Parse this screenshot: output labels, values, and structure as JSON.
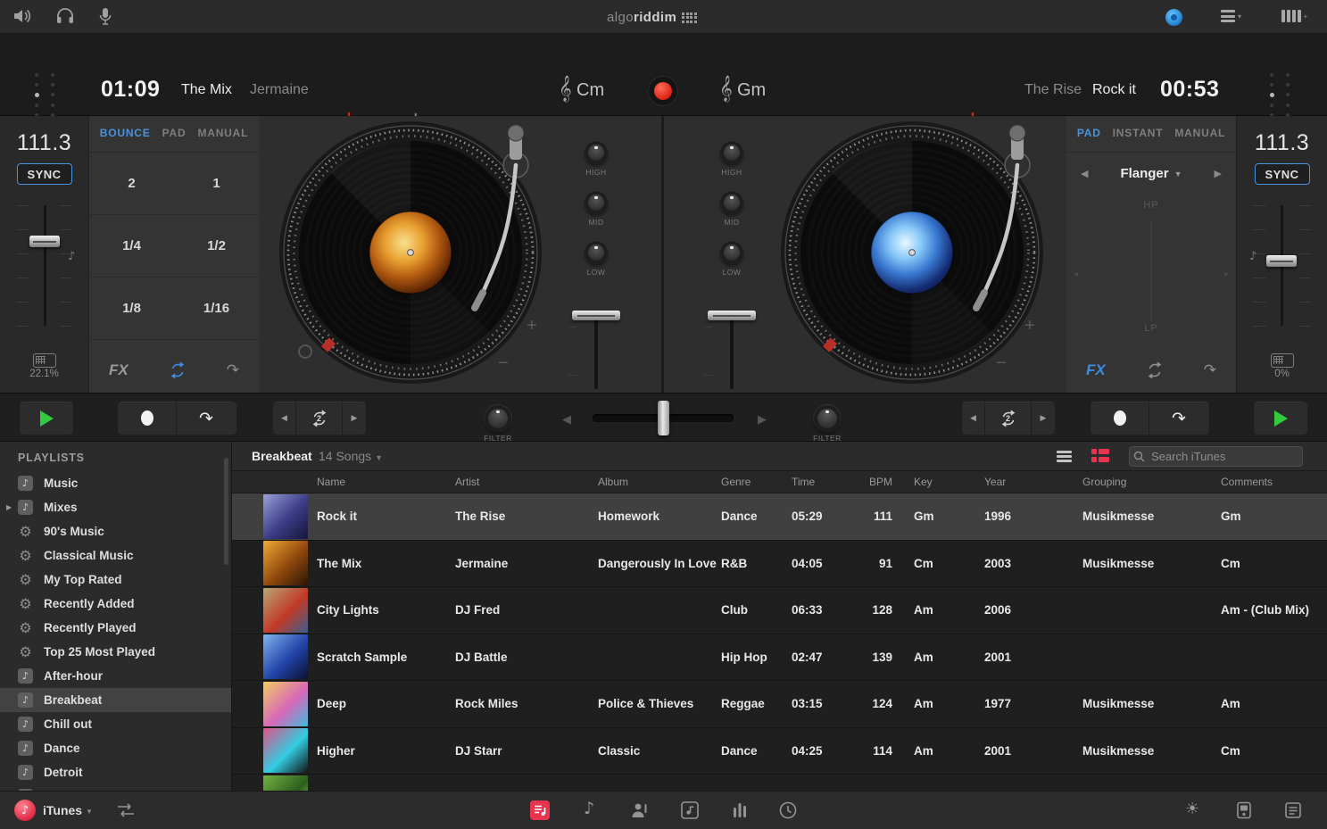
{
  "colors": {
    "accent_blue": "#4a93dd",
    "play_green": "#33cb3e",
    "record_red": "#d81f12",
    "active_pink": "#e8344e",
    "meter_green": "#3ed54b"
  },
  "menubar": {
    "logo_light": "algo",
    "logo_bold": "riddim"
  },
  "deck_a": {
    "time": "01:09",
    "title": "The Mix",
    "artist": "Jermaine",
    "key": "Cm",
    "bpm": "111.3",
    "sync_label": "SYNC",
    "pitch_pct": "22.1%",
    "tabs": [
      "BOUNCE",
      "PAD",
      "MANUAL"
    ],
    "active_tab": "BOUNCE",
    "loops": [
      "2",
      "1",
      "1/4",
      "1/2",
      "1/8",
      "1/16"
    ],
    "loop_len": "2",
    "fx_label": "FX"
  },
  "deck_b": {
    "time": "00:53",
    "title": "Rock it",
    "artist": "The Rise",
    "key": "Gm",
    "bpm": "111.3",
    "sync_label": "SYNC",
    "pitch_pct": "0%",
    "tabs": [
      "PAD",
      "INSTANT",
      "MANUAL"
    ],
    "active_tab": "PAD",
    "fx_name": "Flanger",
    "hp_label": "HP",
    "lp_label": "LP",
    "loop_len": "2",
    "fx_label": "FX"
  },
  "mixer": {
    "eq_labels": [
      "HIGH",
      "MID",
      "LOW"
    ],
    "filter_label": "FILTER"
  },
  "sidebar": {
    "header": "PLAYLISTS",
    "items": [
      {
        "label": "Music",
        "icon": "note"
      },
      {
        "label": "Mixes",
        "icon": "note",
        "disclosure": true
      },
      {
        "label": "90's Music",
        "icon": "gear"
      },
      {
        "label": "Classical Music",
        "icon": "gear"
      },
      {
        "label": "My Top Rated",
        "icon": "gear"
      },
      {
        "label": "Recently Added",
        "icon": "gear"
      },
      {
        "label": "Recently Played",
        "icon": "gear"
      },
      {
        "label": "Top 25 Most Played",
        "icon": "gear"
      },
      {
        "label": "After-hour",
        "icon": "note"
      },
      {
        "label": "Breakbeat",
        "icon": "note",
        "selected": true
      },
      {
        "label": "Chill out",
        "icon": "note"
      },
      {
        "label": "Dance",
        "icon": "note"
      },
      {
        "label": "Detroit",
        "icon": "note"
      },
      {
        "label": "",
        "icon": "note"
      }
    ],
    "source_label": "iTunes"
  },
  "library": {
    "playlist_name": "Breakbeat",
    "count_label": "14 Songs",
    "search_placeholder": "Search iTunes",
    "columns": [
      "Name",
      "Artist",
      "Album",
      "Genre",
      "Time",
      "BPM",
      "Key",
      "Year",
      "Grouping",
      "Comments"
    ],
    "rows": [
      {
        "name": "Rock it",
        "artist": "The Rise",
        "album": "Homework",
        "genre": "Dance",
        "time": "05:29",
        "bpm": "111",
        "key": "Gm",
        "year": "1996",
        "grouping": "Musikmesse",
        "comments": "Gm",
        "selected": true,
        "art": [
          "#9aa0d8",
          "#3a3a85",
          "#16163a"
        ]
      },
      {
        "name": "The Mix",
        "artist": "Jermaine",
        "album": "Dangerously In Love",
        "genre": "R&B",
        "time": "04:05",
        "bpm": "91",
        "key": "Cm",
        "year": "2003",
        "grouping": "Musikmesse",
        "comments": "Cm",
        "selected": false,
        "art": [
          "#f2a834",
          "#90480d",
          "#2a1505"
        ]
      },
      {
        "name": "City Lights",
        "artist": "DJ Fred",
        "album": "",
        "genre": "Club",
        "time": "06:33",
        "bpm": "128",
        "key": "Am",
        "year": "2006",
        "grouping": "",
        "comments": "Am - (Club Mix)",
        "selected": false,
        "art": [
          "#b8a878",
          "#c23a26",
          "#3a5e90"
        ]
      },
      {
        "name": "Scratch Sample",
        "artist": "DJ Battle",
        "album": "",
        "genre": "Hip Hop",
        "time": "02:47",
        "bpm": "139",
        "key": "Am",
        "year": "2001",
        "grouping": "",
        "comments": "",
        "selected": false,
        "art": [
          "#82b4f0",
          "#2244a8",
          "#0a1030"
        ]
      },
      {
        "name": "Deep",
        "artist": "Rock Miles",
        "album": "Police & Thieves",
        "genre": "Reggae",
        "time": "03:15",
        "bpm": "124",
        "key": "Am",
        "year": "1977",
        "grouping": "Musikmesse",
        "comments": "Am",
        "selected": false,
        "art": [
          "#f2cc60",
          "#d868b8",
          "#3ebcdc"
        ]
      },
      {
        "name": "Higher",
        "artist": "DJ Starr",
        "album": "Classic",
        "genre": "Dance",
        "time": "04:25",
        "bpm": "114",
        "key": "Am",
        "year": "2001",
        "grouping": "Musikmesse",
        "comments": "Cm",
        "selected": false,
        "art": [
          "#e25288",
          "#32cce2",
          "#141414"
        ]
      },
      {
        "name": "",
        "artist": "",
        "album": "",
        "genre": "",
        "time": "",
        "bpm": "",
        "key": "",
        "year": "",
        "grouping": "",
        "comments": "",
        "selected": false,
        "art": [
          "#74b244",
          "#2c5e1c",
          "#cce488"
        ]
      }
    ]
  }
}
